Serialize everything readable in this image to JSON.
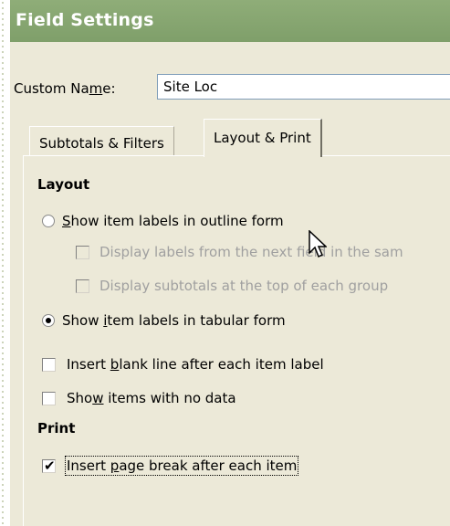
{
  "window": {
    "title": "Field Settings"
  },
  "custom_name": {
    "label_pre": "Custom Na",
    "label_accel": "m",
    "label_post": "e:",
    "value": "Site Loc"
  },
  "tabs": [
    {
      "label": "Subtotals & Filters"
    },
    {
      "label": "Layout & Print"
    }
  ],
  "layout": {
    "heading": "Layout",
    "outline_radio": {
      "accel": "S",
      "rest": "how item labels in outline form",
      "selected": false
    },
    "next_field_check": {
      "label": "Display labels from the next field in the sam",
      "checked": false,
      "enabled": false
    },
    "subtotals_top_check": {
      "label": "Display subtotals at the top of each group",
      "checked": false,
      "enabled": false
    },
    "tabular_radio": {
      "pre": "Show ",
      "accel": "i",
      "rest": "tem labels in tabular form",
      "selected": true
    },
    "blank_line_check": {
      "pre": "Insert ",
      "accel": "b",
      "rest": "lank line after each item label",
      "checked": false
    },
    "no_data_check": {
      "pre": "Sho",
      "accel": "w",
      "rest": " items with no data",
      "checked": false
    }
  },
  "print": {
    "heading": "Print",
    "page_break_check": {
      "pre": "Insert ",
      "accel": "p",
      "rest": "age break after each item",
      "checked": true
    }
  }
}
